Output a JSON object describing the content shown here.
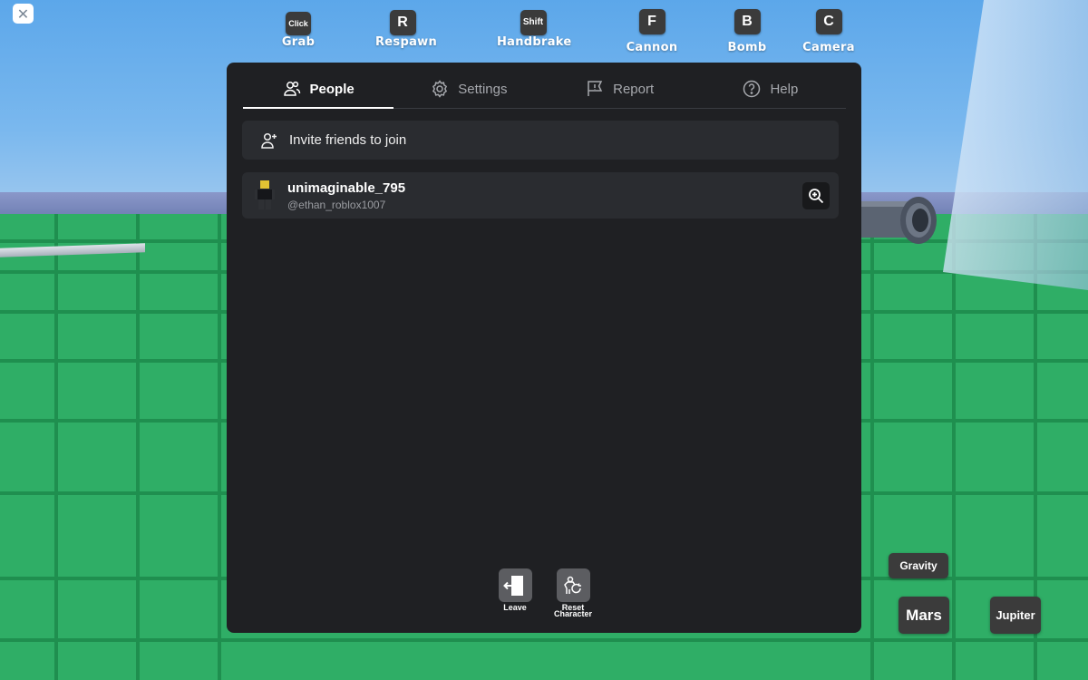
{
  "hints": [
    {
      "key": "Click",
      "label": "Grab"
    },
    {
      "key": "R",
      "label": "Respawn"
    },
    {
      "key": "Shift",
      "label": "Handbrake"
    },
    {
      "key": "F",
      "label": "Cannon"
    },
    {
      "key": "B",
      "label": "Bomb"
    },
    {
      "key": "C",
      "label": "Camera"
    }
  ],
  "close_glyph": "✕",
  "tabs": [
    {
      "label": "People",
      "icon": "people-icon",
      "active": true
    },
    {
      "label": "Settings",
      "icon": "gear-icon",
      "active": false
    },
    {
      "label": "Report",
      "icon": "flag-icon",
      "active": false
    },
    {
      "label": "Help",
      "icon": "help-icon",
      "active": false
    }
  ],
  "invite": {
    "label": "Invite friends to join",
    "icon": "add-friend-icon"
  },
  "player": {
    "display_name": "unimaginable_795",
    "username": "@ethan_roblox1007"
  },
  "actions": [
    {
      "label": "Leave",
      "icon": "leave-icon"
    },
    {
      "label": "Reset Character",
      "label_line1": "Reset",
      "label_line2": "Character",
      "icon": "reset-icon"
    }
  ],
  "world_buttons": {
    "gravity": "Gravity",
    "mars": "Mars",
    "jupiter": "Jupiter"
  },
  "colors": {
    "panel": "#1f2023",
    "row": "#2a2c30",
    "ground": "#2fae66",
    "key": "#3b3b3b"
  }
}
